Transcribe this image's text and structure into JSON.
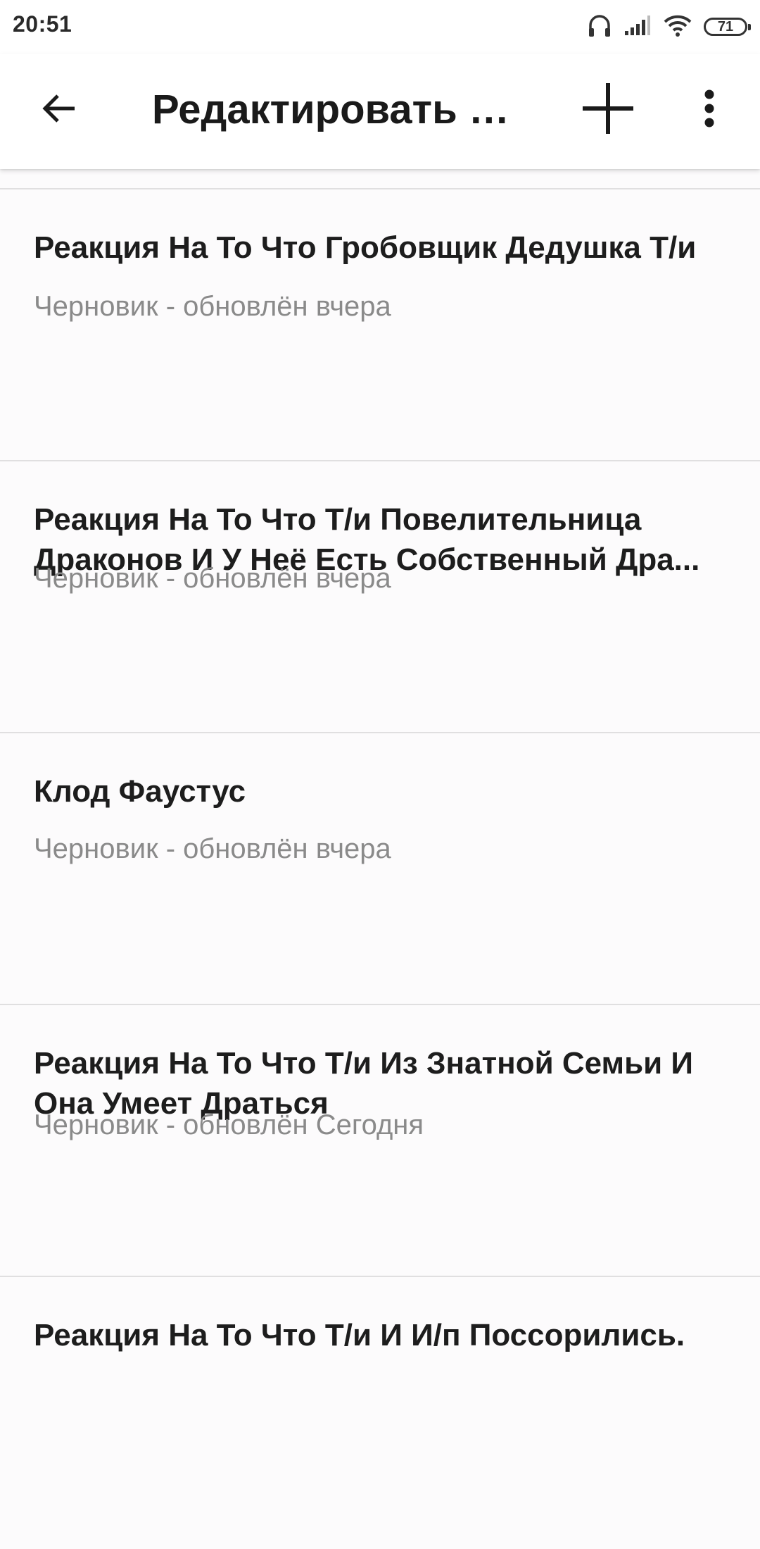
{
  "status_bar": {
    "time": "20:51",
    "battery": "71",
    "icons": [
      "headphones-icon",
      "signal-icon",
      "wifi-icon",
      "battery-icon"
    ]
  },
  "app_bar": {
    "title": "Редактировать и...",
    "icons": [
      "back-arrow-icon",
      "plus-icon",
      "more-vert-icon"
    ]
  },
  "stories": [
    {
      "title": "Реакция На То Что Гробовщик Дедушка Т/и",
      "status": "Черновик - обновлён вчера"
    },
    {
      "title": "Реакция На То Что Т/и Повелительница Драконов И У Неё Есть Собственный Дра...",
      "status": "Черновик - обновлён вчера"
    },
    {
      "title": "Клод Фаустус",
      "status": "Черновик - обновлён вчера"
    },
    {
      "title": "Реакция На То Что Т/и Из Знатной Семьи И Она Умеет Драться",
      "status": "Черновик - обновлён Сегодня"
    },
    {
      "title": "Реакция На То Что Т/и И И/п Поссорились."
    }
  ]
}
